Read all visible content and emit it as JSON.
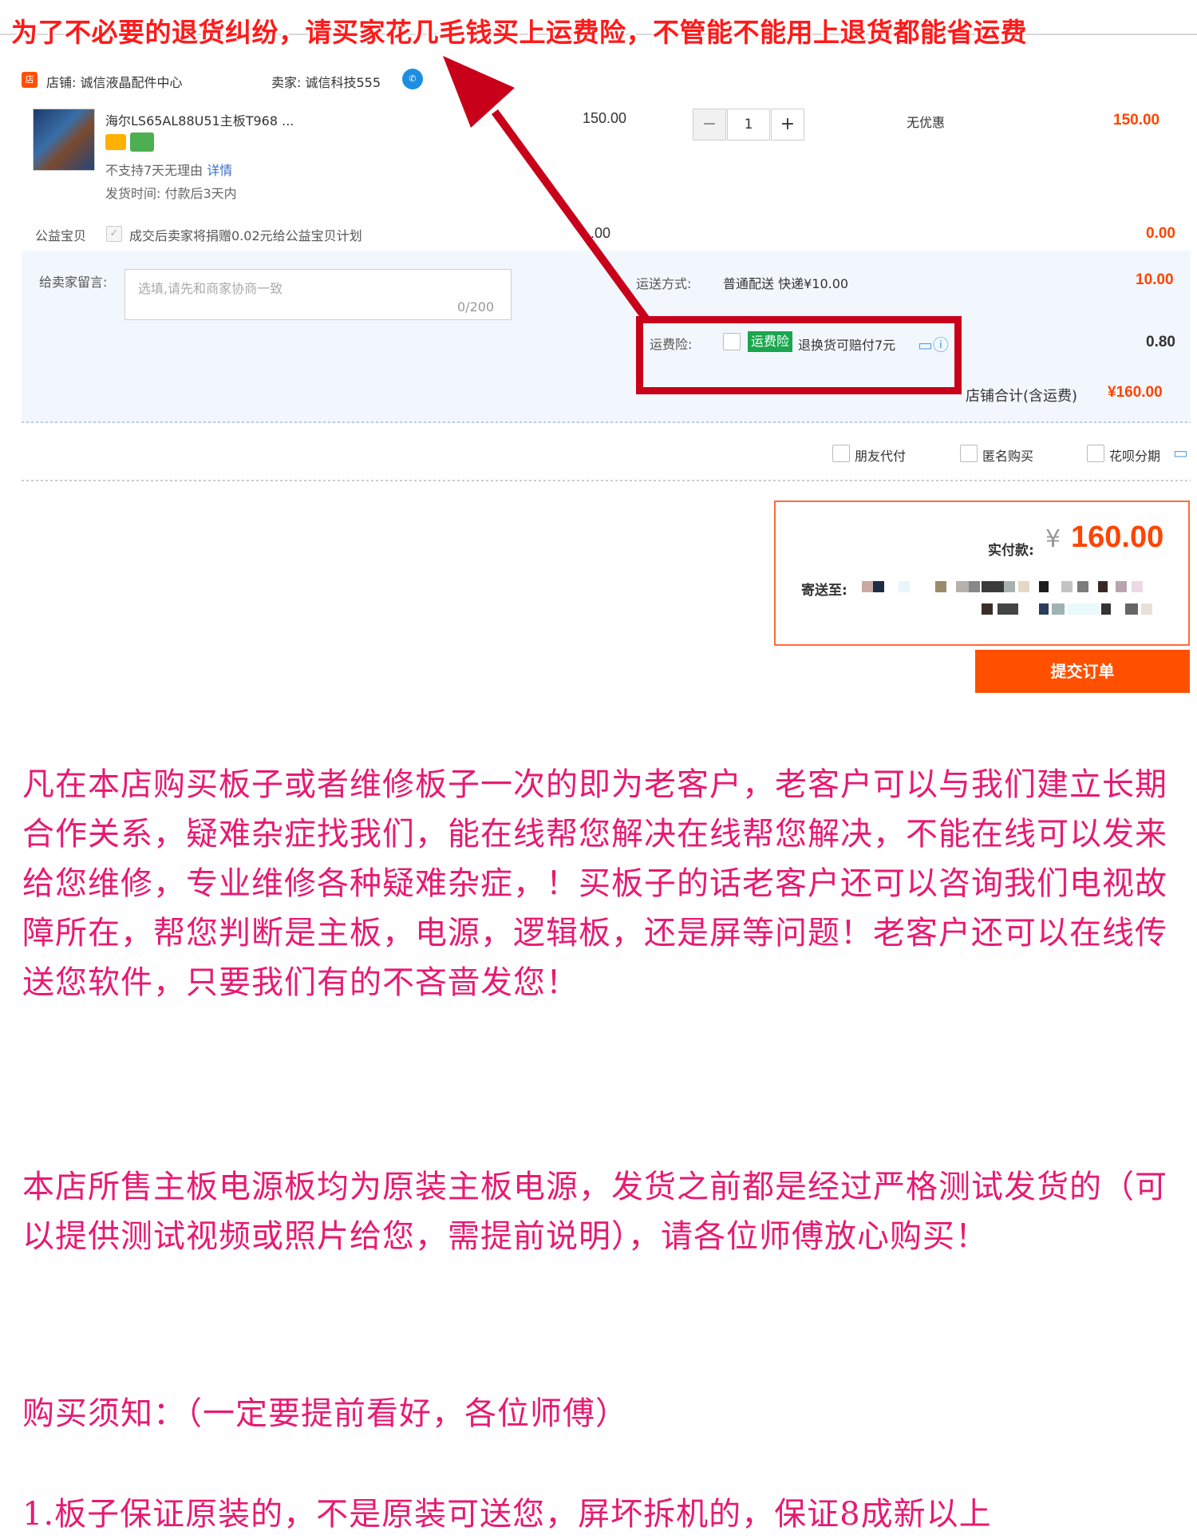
{
  "banner": {
    "text": "为了不必要的退货纠纷，请买家花几毛钱买上运费险，不管能不能用上退货都能省运费"
  },
  "shop": {
    "label": "店铺: 诚信液晶配件中心",
    "seller": "卖家: 诚信科技555"
  },
  "product": {
    "title": "海尔LS65AL88U51主板T968 ...",
    "no_return": "不支持7天无理由",
    "details_link": "详情",
    "ship_time": "发货时间: 付款后3天内",
    "price": "150.00",
    "quantity": "1",
    "discount": "无优惠",
    "subtotal": "150.00"
  },
  "charity": {
    "label": "公益宝贝",
    "text": "成交后卖家将捐赠0.02元给公益宝贝计划",
    "price": ".00",
    "amount": "0.00"
  },
  "message": {
    "label": "给卖家留言:",
    "placeholder": "选填,请先和商家协商一致",
    "counter": "0/200"
  },
  "shipping": {
    "label": "运送方式:",
    "method": "普通配送 快递¥10.00",
    "amount": "10.00"
  },
  "insurance": {
    "label": "运费险:",
    "tag": "运费险",
    "text": "退换货可赔付7元",
    "amount": "0.80"
  },
  "shop_total": {
    "label": "店铺合计(含运费)",
    "amount": "¥160.00"
  },
  "options": {
    "friend_pay": "朋友代付",
    "anonymous": "匿名购买",
    "huabei": "花呗分期"
  },
  "summary": {
    "pay_label": "实付款:",
    "currency": "¥",
    "pay_amount": "160.00",
    "ship_to_label": "寄送至:",
    "submit_label": "提交订单"
  },
  "paragraphs": {
    "p1": "凡在本店购买板子或者维修板子一次的即为老客户，老客户可以与我们建立长期合作关系，疑难杂症找我们，能在线帮您解决在线帮您解决，不能在线可以发来给您维修，专业维修各种疑难杂症，！买板子的话老客户还可以咨询我们电视故障所在，帮您判断是主板，电源，逻辑板，还是屏等问题！老客户还可以在线传送您软件，只要我们有的不吝啬发您！",
    "p2": "本店所售主板电源板均为原装主板电源，发货之前都是经过严格测试发货的（可以提供测试视频或照片给您，需提前说明），请各位师傅放心购买！",
    "p3": "购买须知：（一定要提前看好，各位师傅）",
    "p4": "1.板子保证原装的，不是原装可送您，屏坏拆机的，保证8成新以上"
  },
  "colors": {
    "accent": "#ff5000",
    "banner_red": "#ff1a1a",
    "annotation_red": "#c8001a",
    "body_text_pink": "#e61b73",
    "insurance_green": "#1aa64e"
  }
}
